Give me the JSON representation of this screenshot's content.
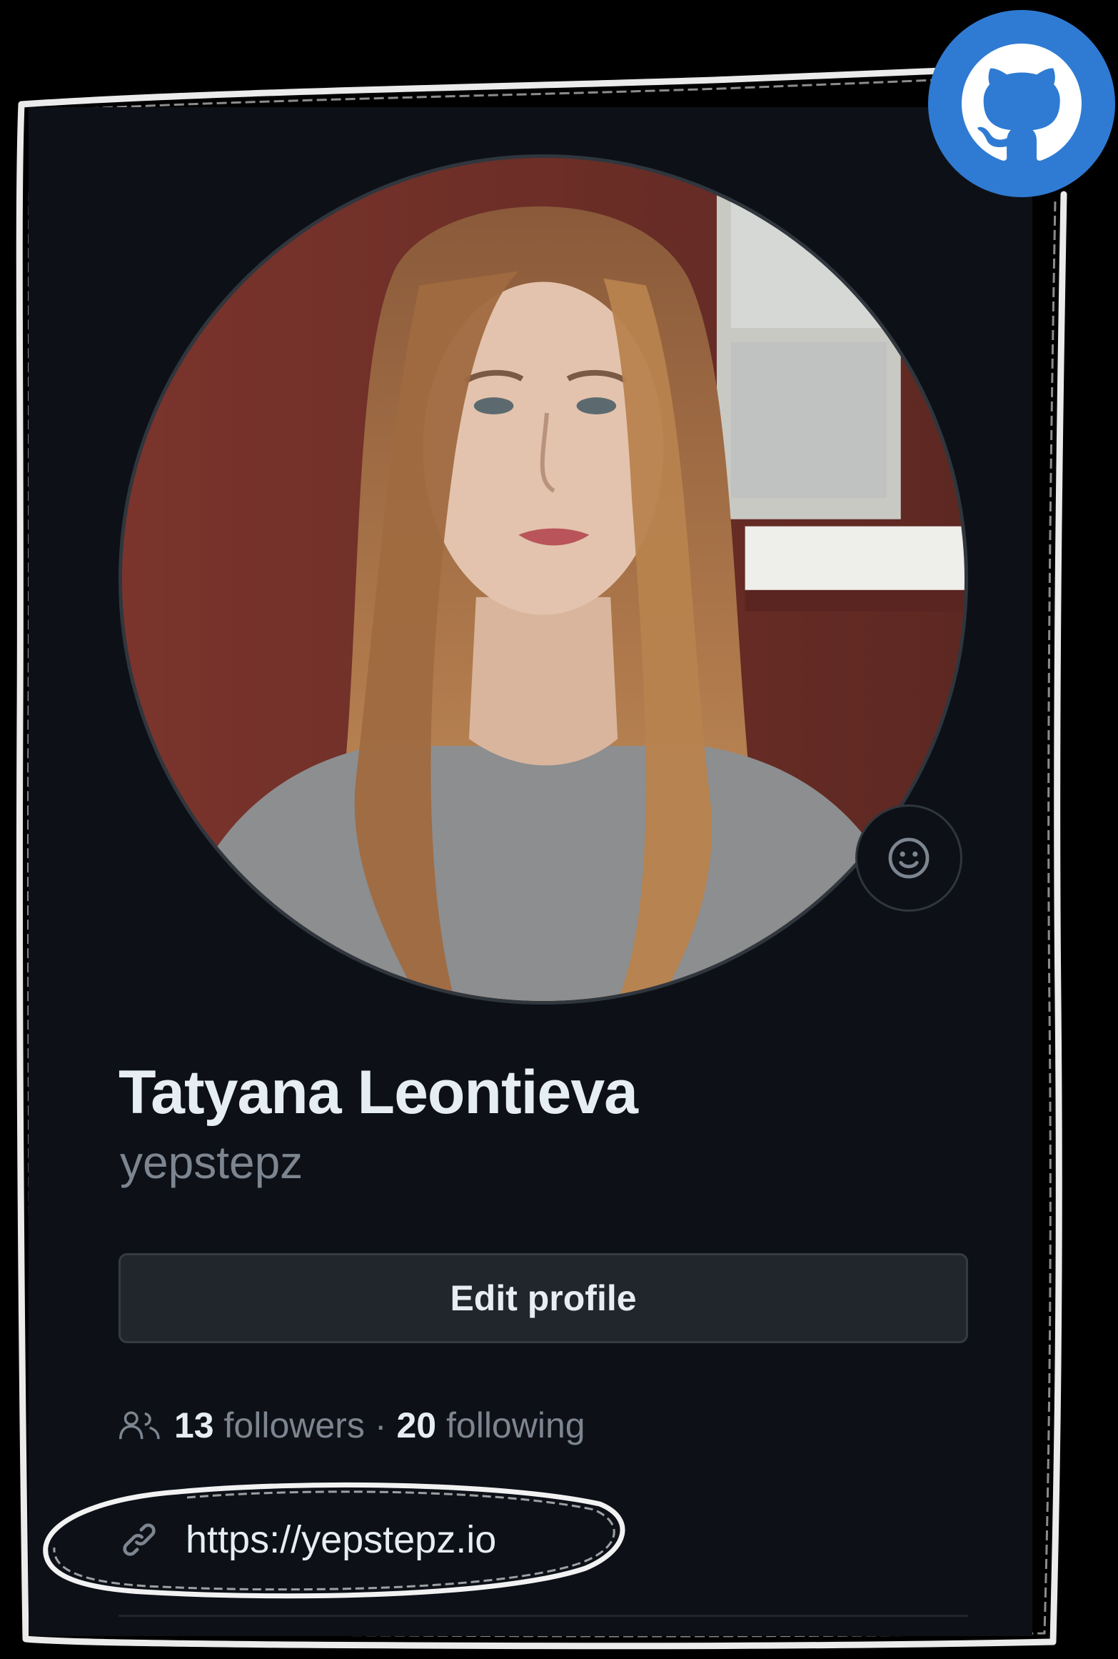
{
  "profile": {
    "full_name": "Tatyana Leontieva",
    "username": "yepstepz",
    "edit_button_label": "Edit profile",
    "followers_count": "13",
    "followers_label": "followers",
    "separator": "·",
    "following_count": "20",
    "following_label": "following",
    "website_url": "https://yepstepz.io"
  },
  "icons": {
    "badge": "github-octocat-icon",
    "status": "smiley-icon",
    "people": "people-icon",
    "link": "link-icon"
  },
  "colors": {
    "background": "#0d1117",
    "primary_text": "#e6edf3",
    "muted_text": "#7d8590",
    "button_bg": "#21262d",
    "border": "#30363d",
    "badge_blue": "#2f7bd3",
    "sketch_outline": "#ffffff"
  }
}
